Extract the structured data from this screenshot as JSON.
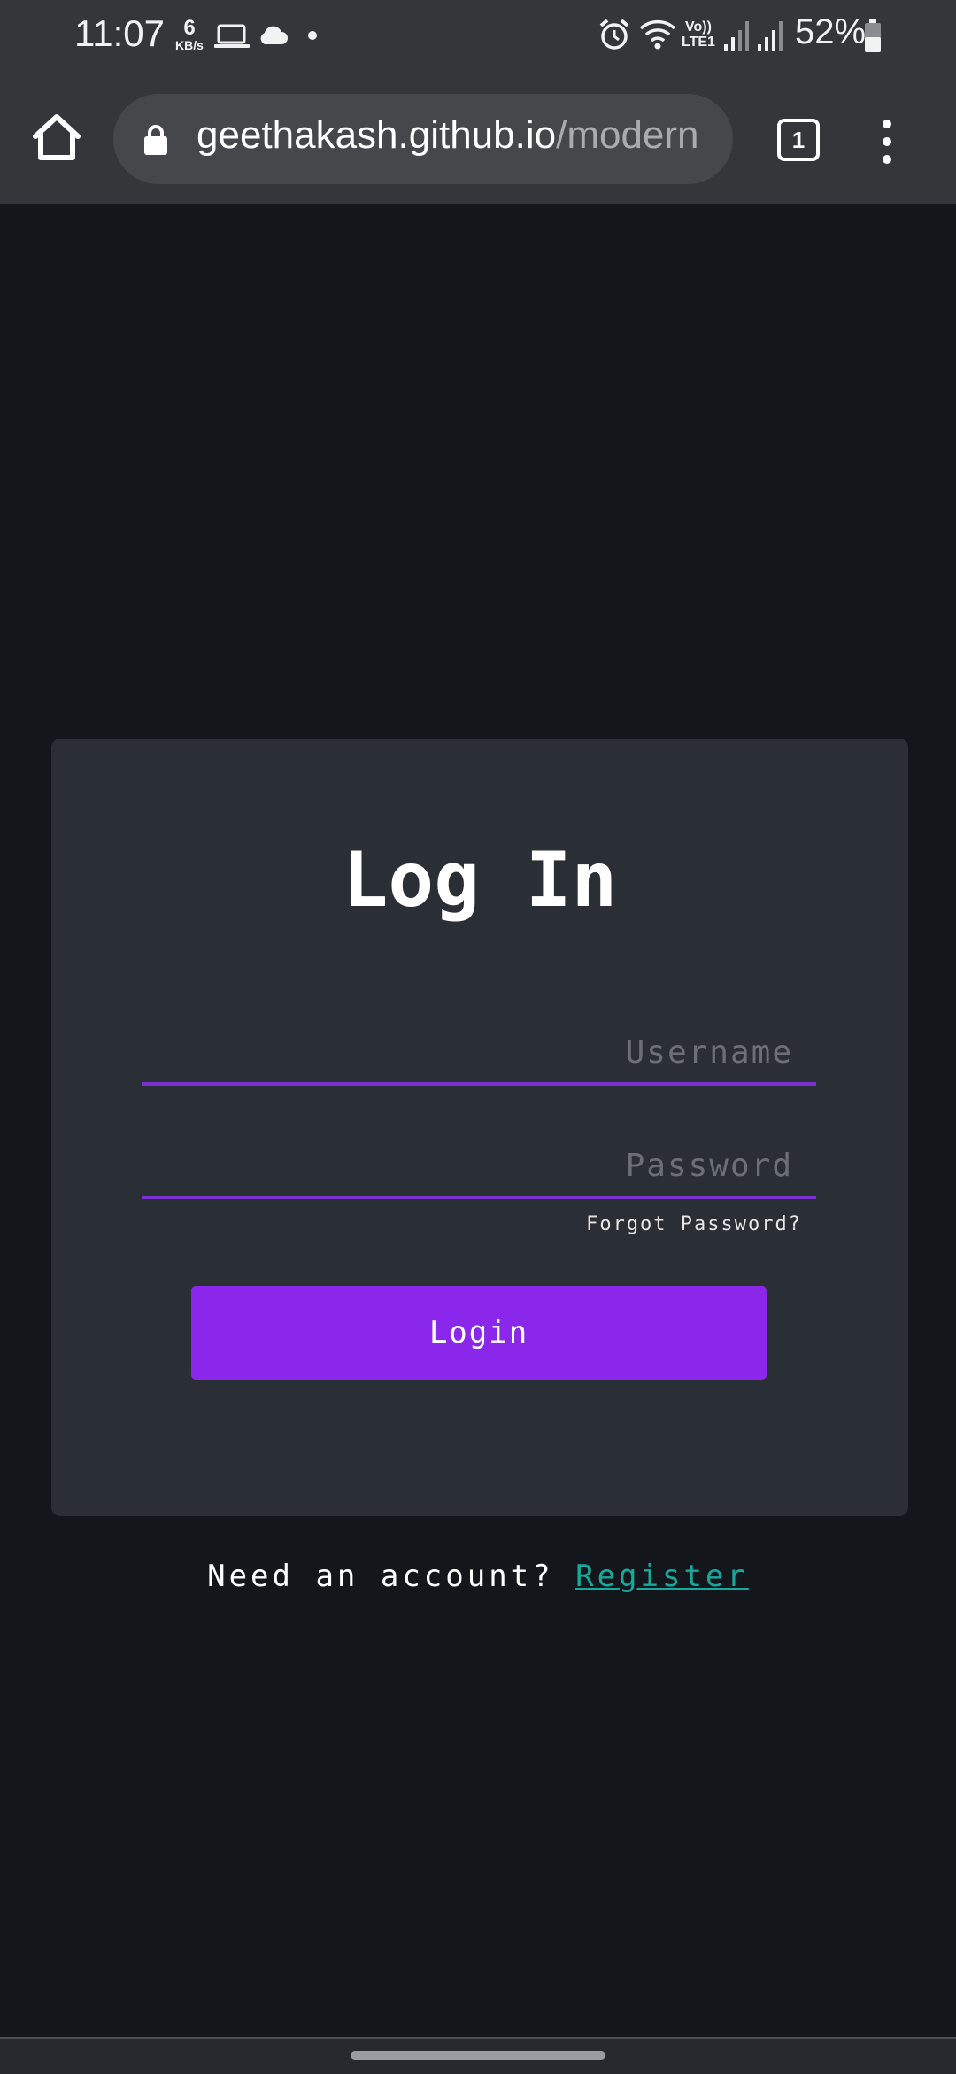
{
  "status_bar": {
    "time": "11:07",
    "speed_value": "6",
    "speed_unit": "KB/s",
    "network_label_1": "Vo))",
    "network_label_2": "LTE1",
    "battery": "52%",
    "icons": [
      "laptop-icon",
      "cloud-icon",
      "dot-icon",
      "alarm-icon",
      "wifi-icon",
      "signal-icon",
      "signal-icon",
      "battery-icon"
    ]
  },
  "browser": {
    "url_host": "geethakash.github.io",
    "url_path": "/modern",
    "tab_count": "1",
    "icons": [
      "home-icon",
      "lock-icon",
      "tabs-icon",
      "more-vert-icon"
    ]
  },
  "login": {
    "title": "Log In",
    "username_placeholder": "Username",
    "password_placeholder": "Password",
    "forgot_label": "Forgot Password?",
    "button_label": "Login",
    "register_prompt": "Need an account?",
    "register_link": "Register"
  },
  "colors": {
    "page_bg": "#13171b",
    "card_bg": "#2a2e35",
    "accent": "#8a27eb",
    "input_underline": "#7b2fd1",
    "link": "#17a99e",
    "chrome_bg": "#34363a"
  }
}
